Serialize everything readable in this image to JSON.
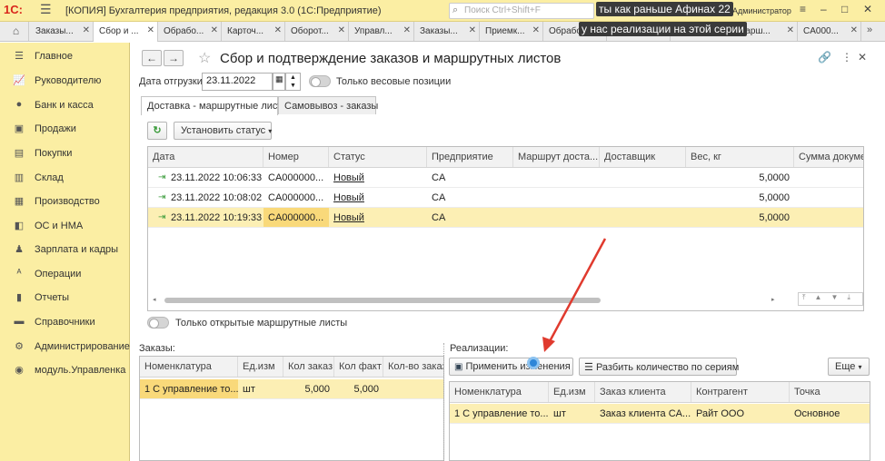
{
  "window": {
    "logo": "1С:",
    "title": "[КОПИЯ] Бухгалтерия предприятия, редакция 3.0  (1С:Предприятие)",
    "search_placeholder": "Поиск Ctrl+Shift+F",
    "user": "Администратор"
  },
  "tabs": [
    {
      "label": "Заказы..."
    },
    {
      "label": "Сбор и ..."
    },
    {
      "label": "Обрабо..."
    },
    {
      "label": "Карточ..."
    },
    {
      "label": "Оборот..."
    },
    {
      "label": "Управл..."
    },
    {
      "label": "Заказы..."
    },
    {
      "label": "Приемк..."
    },
    {
      "label": "Обрабо..."
    },
    {
      "label": "..."
    },
    {
      "label": "...арш..."
    },
    {
      "label": "CA000..."
    }
  ],
  "overlay": {
    "caption1": "ты как раньше Афинах 22",
    "caption2": "у нас реализации на этой серии"
  },
  "sidebar": {
    "items": [
      {
        "label": "Главное",
        "icon": "menu-icon"
      },
      {
        "label": "Руководителю",
        "icon": "chart-icon"
      },
      {
        "label": "Банк и касса",
        "icon": "coin-icon"
      },
      {
        "label": "Продажи",
        "icon": "basket-icon"
      },
      {
        "label": "Покупки",
        "icon": "cart-icon"
      },
      {
        "label": "Склад",
        "icon": "warehouse-icon"
      },
      {
        "label": "Производство",
        "icon": "factory-icon"
      },
      {
        "label": "ОС и НМА",
        "icon": "assets-icon"
      },
      {
        "label": "Зарплата и кадры",
        "icon": "person-icon"
      },
      {
        "label": "Операции",
        "icon": "operations-icon"
      },
      {
        "label": "Отчеты",
        "icon": "reports-icon"
      },
      {
        "label": "Справочники",
        "icon": "book-icon"
      },
      {
        "label": "Администрирование",
        "icon": "gear-icon"
      },
      {
        "label": "модуль.Управленка",
        "icon": "module-icon"
      }
    ]
  },
  "form": {
    "title": "Сбор и подтверждение заказов и маршрутных листов",
    "ship_date_label": "Дата отгрузки:",
    "ship_date_value": "23.11.2022",
    "weight_toggle_label": "Только весовые позиции",
    "tab_delivery": "Доставка - маршрутные листы",
    "tab_pickup": "Самовывоз - заказы",
    "set_status_label": "Установить статус",
    "only_open_label": "Только открытые маршрутные листы",
    "more_label": "Еще"
  },
  "orders_grid": {
    "columns": [
      "Дата",
      "Номер",
      "Статус",
      "Предприятие",
      "Маршрут доста...",
      "Доставщик",
      "Вес, кг",
      "Сумма докуме..."
    ],
    "rows": [
      {
        "date": "23.11.2022 10:06:33",
        "number": "CA000000...",
        "status": "Новый",
        "company": "CA",
        "weight": "5,0000"
      },
      {
        "date": "23.11.2022 10:08:02",
        "number": "CA000000...",
        "status": "Новый",
        "company": "CA",
        "weight": "5,0000"
      },
      {
        "date": "23.11.2022 10:19:33",
        "number": "CA000000...",
        "status": "Новый",
        "company": "CA",
        "weight": "5,0000"
      }
    ]
  },
  "orders_panel": {
    "label": "Заказы:",
    "columns": [
      "Номенклатура",
      "Ед.изм",
      "Кол заказ",
      "Кол факт",
      "Кол-во заказ"
    ],
    "rows": [
      {
        "item": "1 С управление то...",
        "unit": "шт",
        "ordered": "5,000",
        "actual": "5,000"
      }
    ]
  },
  "sales_panel": {
    "label": "Реализации:",
    "apply_label": "Применить изменения",
    "split_label": "Разбить количество по сериям",
    "columns": [
      "Номенклатура",
      "Ед.изм",
      "Заказ клиента",
      "Контрагент",
      "Точка"
    ],
    "rows": [
      {
        "item": "1 С управление то...",
        "unit": "шт",
        "order": "Заказ клиента CA...",
        "counterparty": "Райт ООО",
        "point": "Основное"
      }
    ]
  },
  "colors": {
    "sidebar_bg": "#fbeea3",
    "selected_row": "#fcefb4",
    "annotation_arrow": "#e03a2e"
  }
}
